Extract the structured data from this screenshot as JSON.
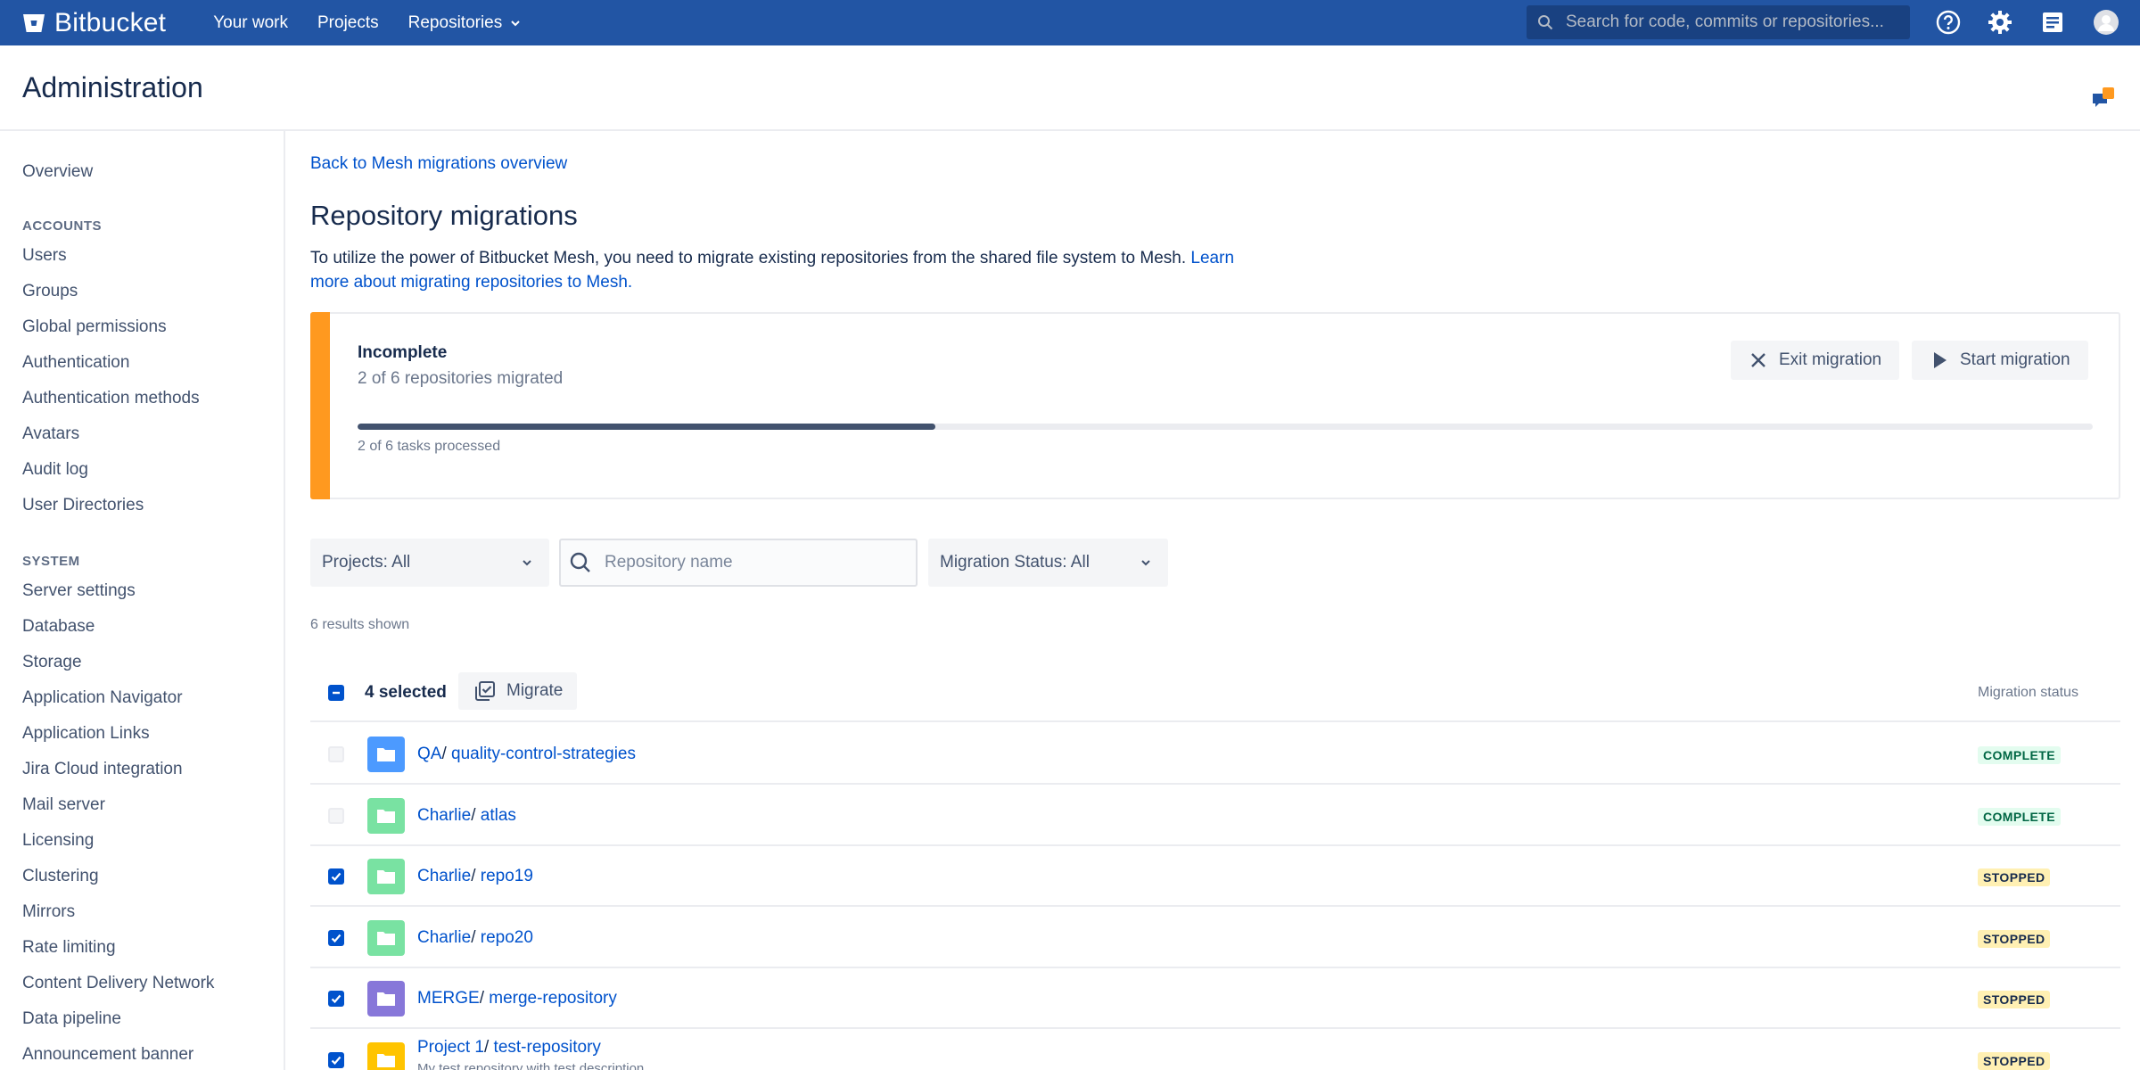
{
  "topnav": {
    "brand": "Bitbucket",
    "items": [
      {
        "label": "Your work"
      },
      {
        "label": "Projects"
      },
      {
        "label": "Repositories"
      }
    ],
    "search_placeholder": "Search for code, commits or repositories...",
    "icons": [
      "help-icon",
      "settings-gear-icon",
      "notes-icon",
      "user-avatar"
    ]
  },
  "header": {
    "title": "Administration",
    "feedback_count": "1"
  },
  "sidebar": {
    "overview": "Overview",
    "accounts_heading": "ACCOUNTS",
    "accounts": [
      "Users",
      "Groups",
      "Global permissions",
      "Authentication",
      "Authentication methods",
      "Avatars",
      "Audit log",
      "User Directories"
    ],
    "system_heading": "SYSTEM",
    "system": [
      "Server settings",
      "Database",
      "Storage",
      "Application Navigator",
      "Application Links",
      "Jira Cloud integration",
      "Mail server",
      "Licensing",
      "Clustering",
      "Mirrors",
      "Rate limiting",
      "Content Delivery Network",
      "Data pipeline",
      "Announcement banner"
    ]
  },
  "main": {
    "back_link": "Back to Mesh migrations overview",
    "title": "Repository migrations",
    "description": "To utilize the power of Bitbucket Mesh, you need to migrate existing repositories from the shared file system to Mesh.",
    "learn_more": "Learn more about migrating repositories to Mesh.",
    "status_card": {
      "title": "Incomplete",
      "subtitle": "2 of 6 repositories migrated",
      "exit_button": "Exit migration",
      "start_button": "Start migration",
      "progress_fraction": 0.333,
      "progress_label": "2 of 6 tasks processed",
      "accent_color": "#ff991f"
    },
    "filters": {
      "projects": "Projects: All",
      "search_placeholder": "Repository name",
      "search_value": "",
      "migration_status": "Migration Status: All"
    },
    "results_text": "6 results shown",
    "table": {
      "selected_label": "4 selected",
      "migrate_button": "Migrate",
      "status_column": "Migration status",
      "rows": [
        {
          "project": "QA",
          "repo": "quality-control-strategies",
          "status": "COMPLETE",
          "checked": false,
          "icon_color": "#4c9aff",
          "description": ""
        },
        {
          "project": "Charlie",
          "repo": "atlas",
          "status": "COMPLETE",
          "checked": false,
          "icon_color": "#79e2a2",
          "description": ""
        },
        {
          "project": "Charlie",
          "repo": "repo19",
          "status": "STOPPED",
          "checked": true,
          "icon_color": "#79e2a2",
          "description": ""
        },
        {
          "project": "Charlie",
          "repo": "repo20",
          "status": "STOPPED",
          "checked": true,
          "icon_color": "#79e2a2",
          "description": ""
        },
        {
          "project": "MERGE",
          "repo": "merge-repository",
          "status": "STOPPED",
          "checked": true,
          "icon_color": "#8777d9",
          "description": ""
        },
        {
          "project": "Project 1",
          "repo": "test-repository",
          "status": "STOPPED",
          "checked": true,
          "icon_color": "#ffc400",
          "description": "My test repository with test description"
        }
      ]
    }
  },
  "colors": {
    "nav_bg": "#2255a4",
    "link": "#0052cc",
    "complete_bg": "#e3fcef",
    "complete_text": "#006644",
    "stopped_bg": "#fff0b3",
    "stopped_text": "#172b4d"
  }
}
